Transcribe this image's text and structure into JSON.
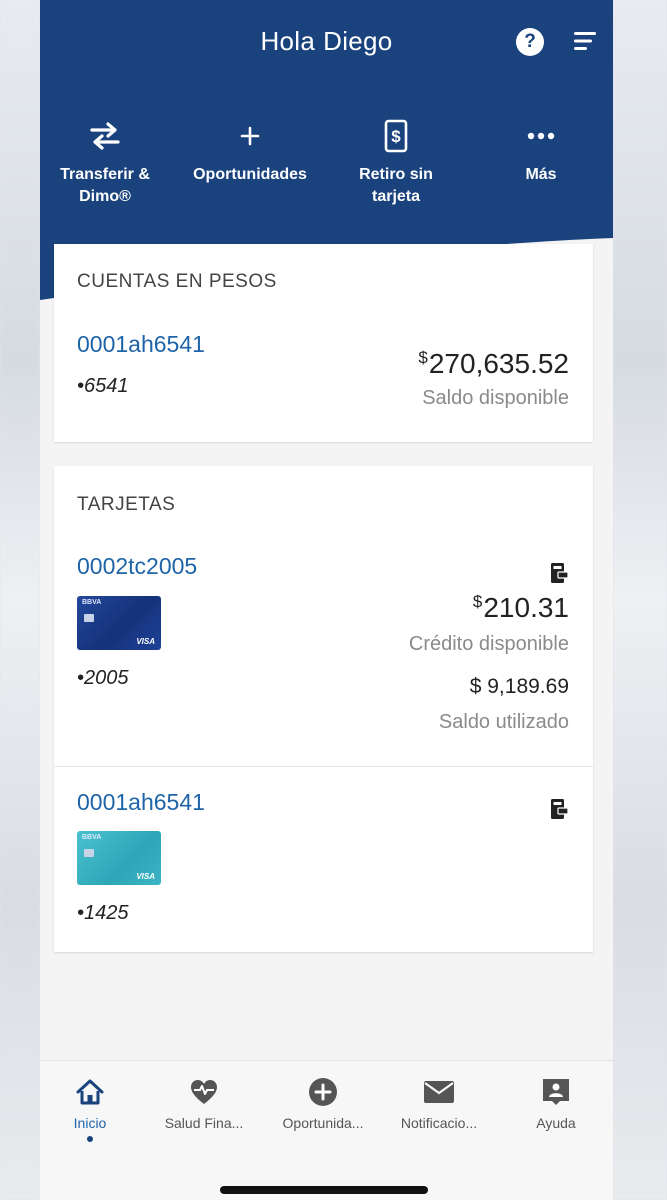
{
  "header": {
    "greeting_prefix": "Hola",
    "user_name": "Diego",
    "help_icon": "help-circle-icon",
    "menu_icon": "menu-icon",
    "bg_color": "#1a427d"
  },
  "quick_actions": [
    {
      "icon": "transfer-arrows-icon",
      "label": "Transferir & Dimo®"
    },
    {
      "icon": "plus-icon",
      "label": "Oportunidades"
    },
    {
      "icon": "cash-withdraw-icon",
      "label": "Retiro sin tarjeta"
    },
    {
      "icon": "more-dots-icon",
      "label": "Más"
    }
  ],
  "accounts": {
    "title": "CUENTAS EN PESOS",
    "items": [
      {
        "name": "0001ah6541",
        "mask": "•6541",
        "currency": "$",
        "balance": "270,635.52",
        "balance_label": "Saldo disponible"
      }
    ]
  },
  "cards": {
    "title": "TARJETAS",
    "items": [
      {
        "name": "0002tc2005",
        "mask": "•2005",
        "card_brand": "BBVA",
        "card_network": "VISA",
        "card_color": "#1b3f8e",
        "currency": "$",
        "credit_available": "210.31",
        "credit_label": "Crédito disponible",
        "used_amount": "$ 9,189.69",
        "used_label": "Saldo utilizado",
        "wallet_icon": "digital-wallet-icon"
      },
      {
        "name": "0001ah6541",
        "mask": "•1425",
        "card_brand": "BBVA",
        "card_network": "VISA",
        "card_color": "#3bb3c4",
        "wallet_icon": "digital-wallet-icon"
      }
    ]
  },
  "tabbar": {
    "items": [
      {
        "icon": "home-icon",
        "label": "Inicio",
        "active": true
      },
      {
        "icon": "heart-pulse-icon",
        "label": "Salud Fina..."
      },
      {
        "icon": "plus-circle-icon",
        "label": "Oportunida..."
      },
      {
        "icon": "mail-icon",
        "label": "Notificacio..."
      },
      {
        "icon": "help-badge-icon",
        "label": "Ayuda"
      }
    ]
  }
}
